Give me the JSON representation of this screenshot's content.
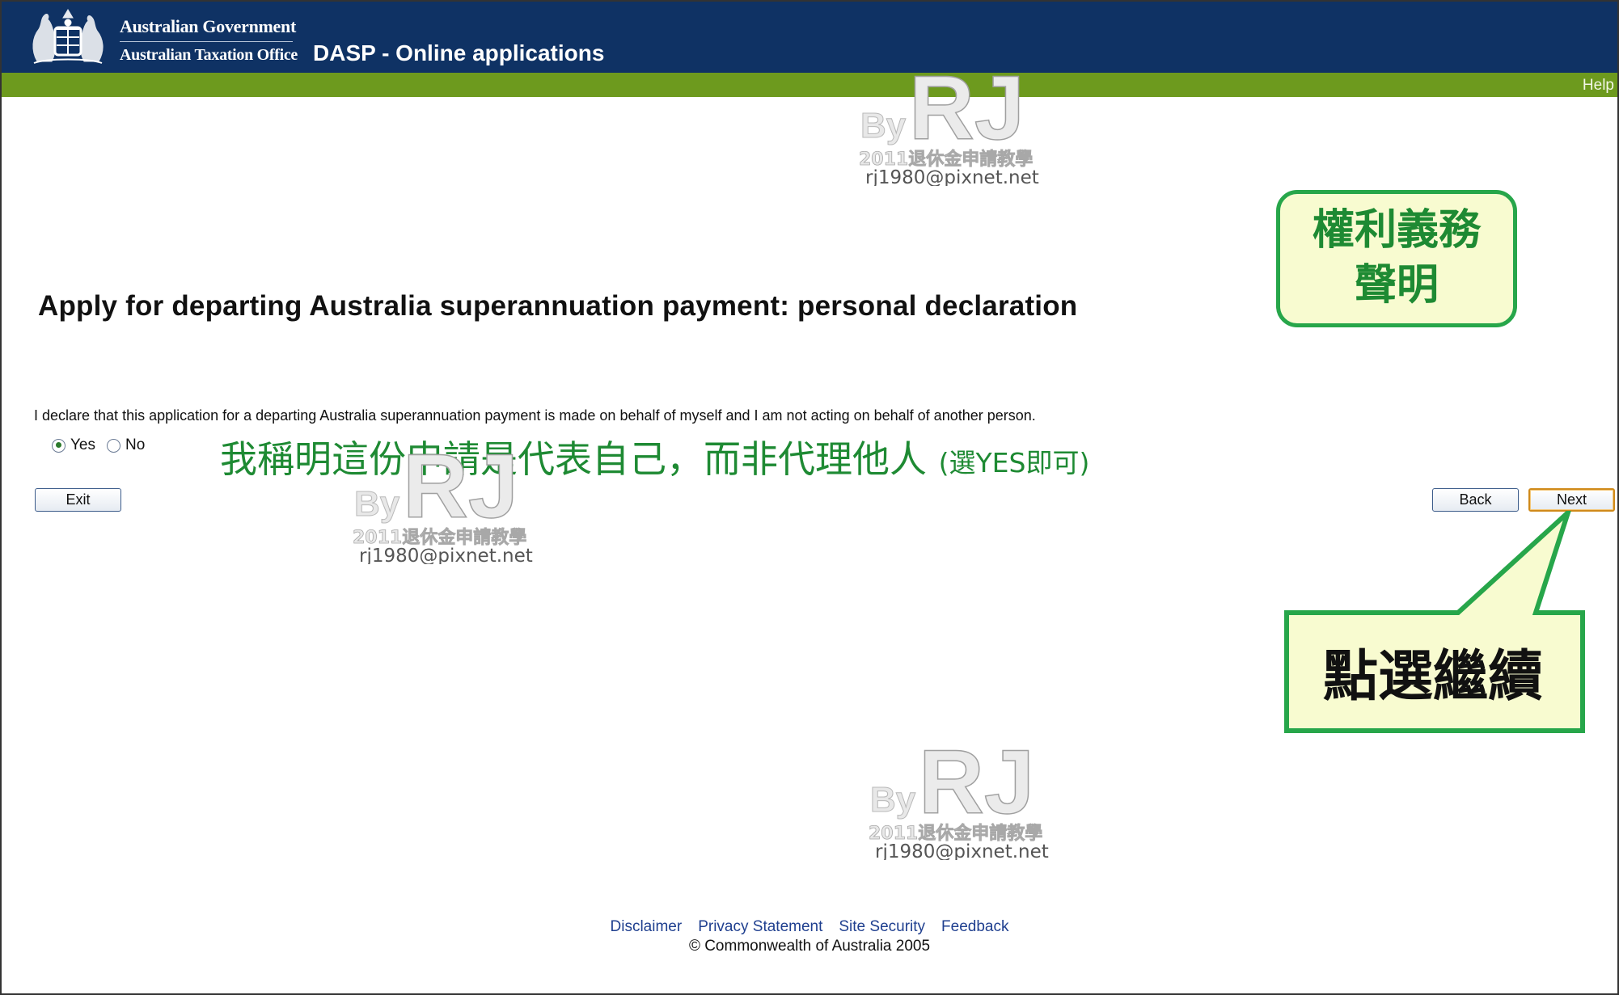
{
  "header": {
    "government": "Australian Government",
    "agency": "Australian Taxation Office",
    "app_title": "DASP - Online applications",
    "help": "Help"
  },
  "page": {
    "heading": "Apply for departing Australia superannuation payment: personal declaration",
    "declaration": "I declare that this application for a departing Australia superannuation payment is made on behalf of myself and I am not acting on behalf of another person.",
    "options": [
      {
        "label": "Yes",
        "selected": true
      },
      {
        "label": "No",
        "selected": false
      }
    ]
  },
  "buttons": {
    "exit": "Exit",
    "back": "Back",
    "next": "Next"
  },
  "annotations": {
    "box_title": "權利義務\n聲明",
    "explanation": "我稱明這份申請是代表自己，而非代理他人",
    "explanation_note": "(選YES即可)",
    "click_next": "點選繼續",
    "accent": "#1e8a33"
  },
  "watermark": {
    "by": "By",
    "rj": "RJ",
    "subtitle": "2011退休金申請教學",
    "email": "rj1980@pixnet.net"
  },
  "footer": {
    "links": [
      "Disclaimer",
      "Privacy Statement",
      "Site Security",
      "Feedback"
    ],
    "copyright": "© Commonwealth of Australia 2005"
  },
  "colors": {
    "header_blue": "#0f3264",
    "header_green": "#6d9a1e",
    "link": "#1f3f8f"
  }
}
